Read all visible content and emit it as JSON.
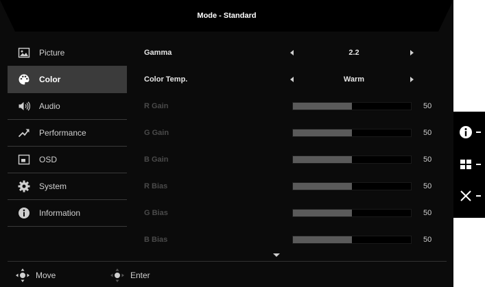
{
  "header": {
    "title": "Mode - Standard"
  },
  "sidebar": {
    "items": [
      {
        "label": "Picture",
        "icon": "picture-icon",
        "selected": false
      },
      {
        "label": "Color",
        "icon": "palette-icon",
        "selected": true
      },
      {
        "label": "Audio",
        "icon": "speaker-icon",
        "selected": false
      },
      {
        "label": "Performance",
        "icon": "trend-arrow-icon",
        "selected": false
      },
      {
        "label": "OSD",
        "icon": "osd-window-icon",
        "selected": false
      },
      {
        "label": "System",
        "icon": "gear-icon",
        "selected": false
      },
      {
        "label": "Information",
        "icon": "info-icon",
        "selected": false
      }
    ]
  },
  "settings": {
    "gamma": {
      "label": "Gamma",
      "value": "2.2"
    },
    "color_temp": {
      "label": "Color Temp.",
      "value": "Warm"
    },
    "r_gain": {
      "label": "R Gain",
      "value": "50",
      "level": 0.5
    },
    "g_gain": {
      "label": "G Gain",
      "value": "50",
      "level": 0.5
    },
    "b_gain": {
      "label": "B Gain",
      "value": "50",
      "level": 0.5
    },
    "r_bias": {
      "label": "R Bias",
      "value": "50",
      "level": 0.5
    },
    "g_bias": {
      "label": "G Bias",
      "value": "50",
      "level": 0.5
    },
    "b_bias": {
      "label": "B Bias",
      "value": "50",
      "level": 0.5
    }
  },
  "footer": {
    "move_label": "Move",
    "enter_label": "Enter"
  },
  "side_panel": {
    "icons": [
      "info-icon",
      "menu-grid-icon",
      "close-icon"
    ]
  },
  "colors": {
    "background": "#0b0b0b",
    "selected": "#3b3b3b",
    "bar_fill": "#5a5a5a",
    "text": "#e6e6e6",
    "dim_text": "#4a4a4a"
  }
}
